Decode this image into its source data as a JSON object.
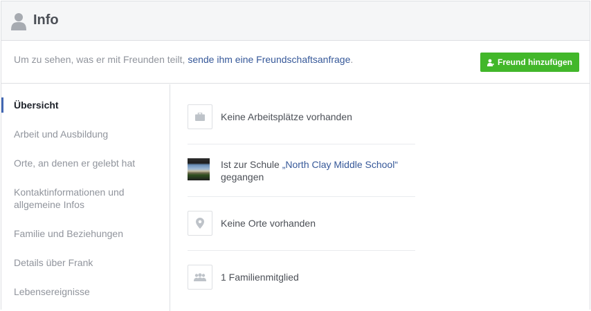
{
  "header": {
    "title": "Info"
  },
  "notice": {
    "prefix": "Um zu sehen, was er mit Freunden teilt, ",
    "link": "sende ihm eine Freundschaftsanfrage",
    "suffix": ".",
    "button_label": "Freund hinzufügen",
    "button_color": "#42b72a"
  },
  "sidebar": {
    "items": [
      {
        "label": "Übersicht"
      },
      {
        "label": "Arbeit und Ausbildung"
      },
      {
        "label": "Orte, an denen er gelebt hat"
      },
      {
        "label": "Kontaktinformationen und allgemeine Infos"
      },
      {
        "label": "Familie und Beziehungen"
      },
      {
        "label": "Details über Frank"
      },
      {
        "label": "Lebensereignisse"
      }
    ]
  },
  "overview": {
    "work": {
      "text": "Keine Arbeitsplätze vorhanden",
      "icon": "briefcase-icon"
    },
    "school": {
      "prefix": "Ist zur Schule ",
      "name": "„North Clay Middle School“",
      "suffix": "gegangen"
    },
    "places": {
      "text": "Keine Orte vorhanden",
      "icon": "location-pin-icon"
    },
    "family": {
      "text": "1 Familienmitglied",
      "icon": "people-icon"
    }
  }
}
